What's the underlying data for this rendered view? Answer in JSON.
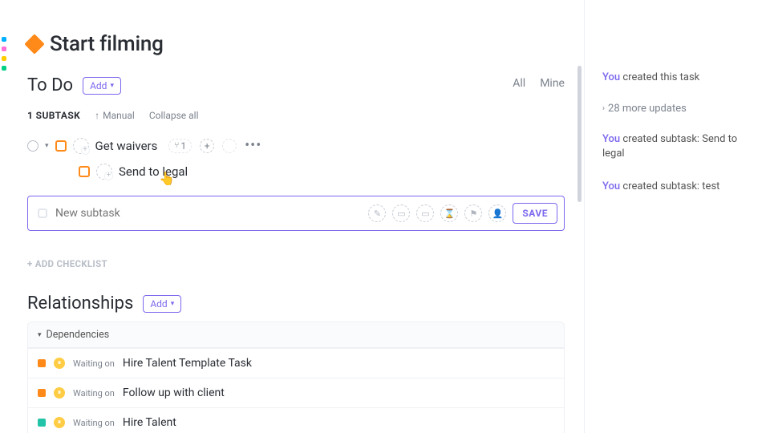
{
  "task": {
    "title": "Start filming"
  },
  "todo": {
    "heading": "To Do",
    "add_label": "Add",
    "filters": {
      "all": "All",
      "mine": "Mine"
    },
    "subtask_count_label": "1 SUBTASK",
    "manual_label": "Manual",
    "collapse_label": "Collapse all"
  },
  "subtasks": [
    {
      "name": "Get waivers",
      "sub_count": "1"
    },
    {
      "name": "Send to legal"
    }
  ],
  "new_subtask": {
    "placeholder": "New subtask",
    "save_label": "SAVE"
  },
  "checklist": {
    "add_label": "+ ADD CHECKLIST"
  },
  "relationships": {
    "heading": "Relationships",
    "add_label": "Add",
    "dependencies_label": "Dependencies",
    "items": [
      {
        "status": "orange",
        "relation": "Waiting on",
        "name": "Hire Talent Template Task"
      },
      {
        "status": "orange",
        "relation": "Waiting on",
        "name": "Follow up with client"
      },
      {
        "status": "teal",
        "relation": "Waiting on",
        "name": "Hire Talent"
      }
    ]
  },
  "activity": {
    "lines": [
      {
        "actor": "You",
        "text": " created this task"
      },
      {
        "actor": "You",
        "text": " created subtask: Send to legal"
      },
      {
        "actor": "You",
        "text": " created subtask: test"
      }
    ],
    "more_updates": "28 more updates"
  }
}
